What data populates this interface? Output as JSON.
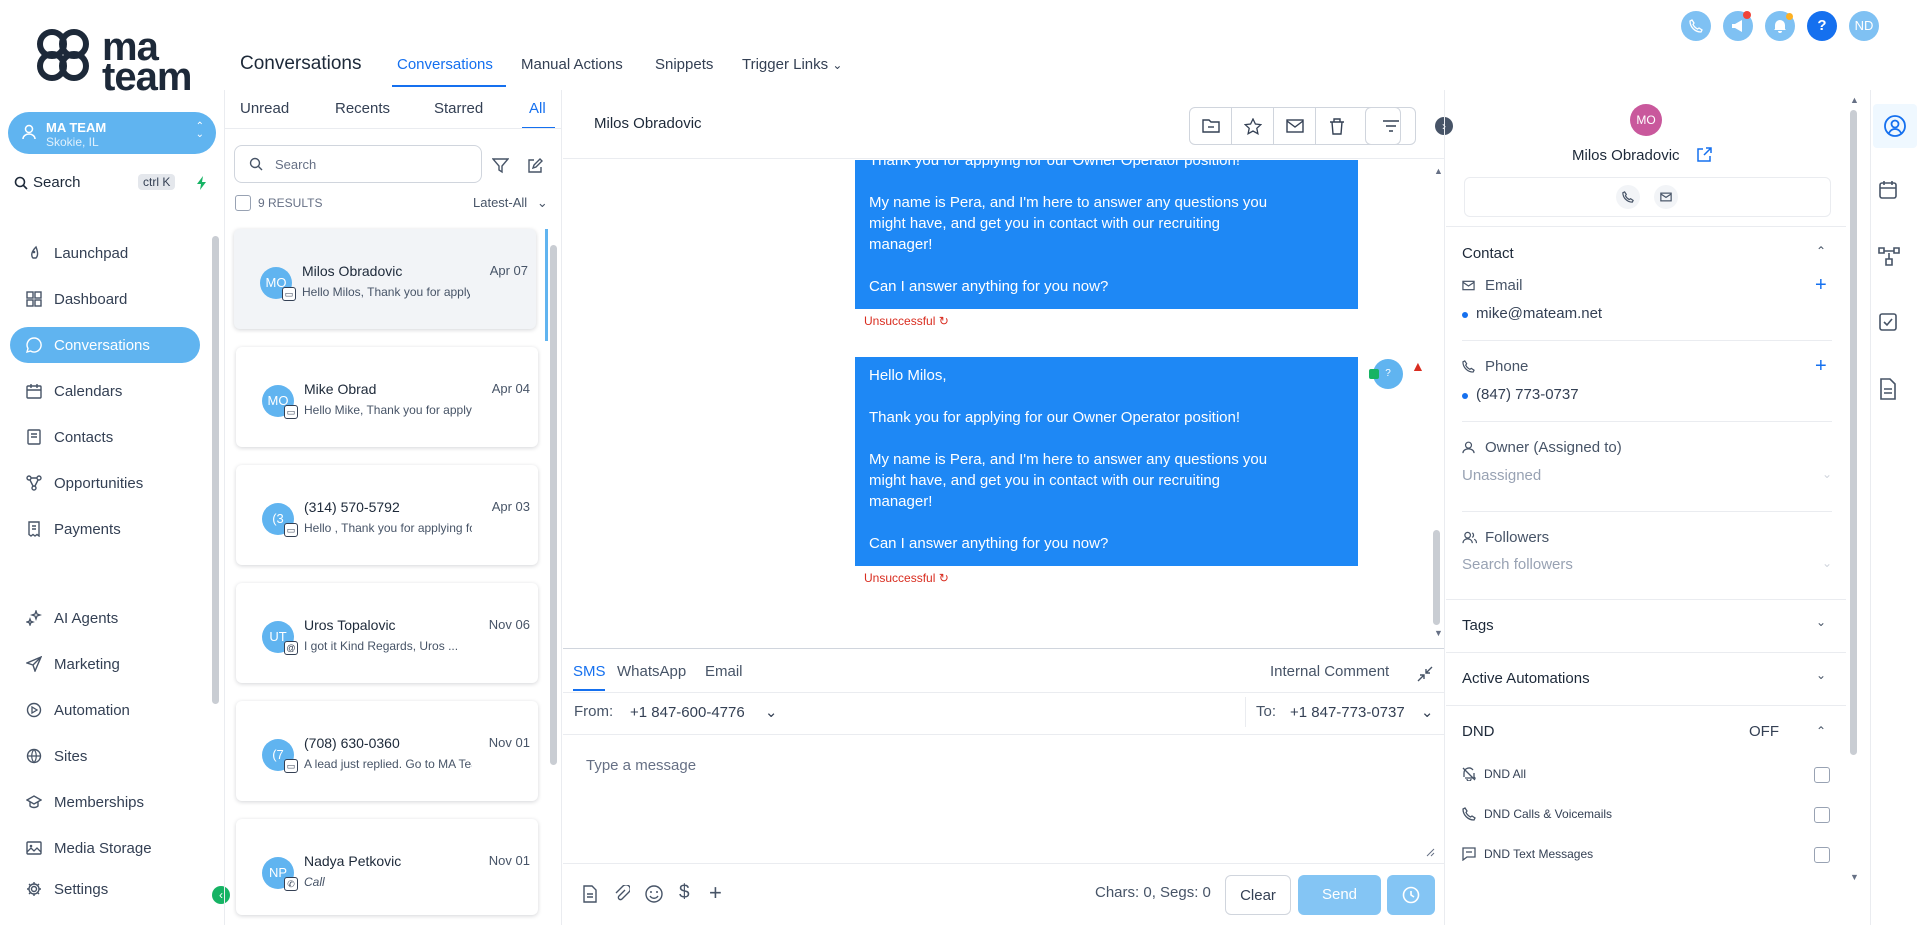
{
  "brand": {
    "logo_text": "ma team"
  },
  "account": {
    "name": "MA TEAM",
    "location": "Skokie, IL"
  },
  "sidebar": {
    "search_label": "Search",
    "search_shortcut": "ctrl K",
    "items": [
      {
        "label": "Launchpad",
        "icon": "rocket-icon"
      },
      {
        "label": "Dashboard",
        "icon": "grid-icon"
      },
      {
        "label": "Conversations",
        "icon": "chat-bubble-icon"
      },
      {
        "label": "Calendars",
        "icon": "calendar-icon"
      },
      {
        "label": "Contacts",
        "icon": "address-book-icon"
      },
      {
        "label": "Opportunities",
        "icon": "network-icon"
      },
      {
        "label": "Payments",
        "icon": "receipt-icon"
      },
      {
        "label": "AI Agents",
        "icon": "sparkle-icon"
      },
      {
        "label": "Marketing",
        "icon": "send-icon"
      },
      {
        "label": "Automation",
        "icon": "automation-icon"
      },
      {
        "label": "Sites",
        "icon": "globe-icon"
      },
      {
        "label": "Memberships",
        "icon": "graduation-cap-icon"
      },
      {
        "label": "Media Storage",
        "icon": "image-icon"
      },
      {
        "label": "Settings",
        "icon": "gear-icon"
      }
    ]
  },
  "header": {
    "title": "Conversations",
    "tabs": [
      "Conversations",
      "Manual Actions",
      "Snippets",
      "Trigger Links"
    ],
    "user_initials": "ND",
    "help": "?"
  },
  "list": {
    "filters": [
      "Unread",
      "Recents",
      "Starred",
      "All"
    ],
    "search_placeholder": "Search",
    "results": "9 RESULTS",
    "sort": "Latest-All",
    "conversations": [
      {
        "initials": "MO",
        "name": "Milos Obradovic",
        "date": "Apr 07",
        "preview": "Hello Milos, Thank you for applying",
        "channel": "sms"
      },
      {
        "initials": "MO",
        "name": "Mike Obrad",
        "date": "Apr 04",
        "preview": "Hello Mike, Thank you for applying",
        "channel": "sms"
      },
      {
        "initials": "(3",
        "name": "(314) 570-5792",
        "date": "Apr 03",
        "preview": "Hello , Thank you for applying for",
        "channel": "sms"
      },
      {
        "initials": "UT",
        "name": "Uros Topalovic",
        "date": "Nov 06",
        "preview": "I got it Kind Regards, Uros ...",
        "channel": "email"
      },
      {
        "initials": "(7",
        "name": "(708) 630-0360",
        "date": "Nov 01",
        "preview": "A lead just replied. Go to MA Team",
        "channel": "sms"
      },
      {
        "initials": "NP",
        "name": "Nadya Petkovic",
        "date": "Nov 01",
        "preview": "Call",
        "channel": "call"
      }
    ]
  },
  "chat": {
    "contact_name": "Milos Obradovic",
    "messages": [
      {
        "lines": [
          "Thank you for applying for our Owner Operator position!",
          "",
          "My name is Pera, and I'm here to answer any questions you",
          "might have, and get you in contact with our recruiting",
          "manager!",
          "",
          "Can I answer anything for you now?"
        ],
        "status": "Unsuccessful"
      },
      {
        "lines": [
          "Hello Milos,",
          "",
          "Thank you for applying for our Owner Operator position!",
          "",
          "My name is Pera, and I'm here to answer any questions you",
          "might have, and get you in contact with our recruiting",
          "manager!",
          "",
          "Can I answer anything for you now?"
        ],
        "status": "Unsuccessful",
        "avatar": "?"
      }
    ]
  },
  "composer": {
    "tabs": [
      "SMS",
      "WhatsApp",
      "Email"
    ],
    "internal_comment": "Internal Comment",
    "from_label": "From:",
    "from_number": "+1 847-600-4776",
    "to_label": "To:",
    "to_number": "+1 847-773-0737",
    "placeholder": "Type a message",
    "counter": "Chars: 0, Segs: 0",
    "clear": "Clear",
    "send": "Send"
  },
  "contact": {
    "initials": "MO",
    "name": "Milos Obradovic",
    "contact_section": "Contact",
    "email_label": "Email",
    "email": "mike@mateam.net",
    "phone_label": "Phone",
    "phone": "(847) 773-0737",
    "owner_label": "Owner (Assigned to)",
    "owner_value": "Unassigned",
    "followers_label": "Followers",
    "followers_placeholder": "Search followers",
    "tags": "Tags",
    "automations": "Active Automations",
    "dnd": "DND",
    "dnd_state": "OFF",
    "dnd_options": [
      "DND All",
      "DND Calls & Voicemails",
      "DND Text Messages"
    ]
  },
  "colors": {
    "accent": "#1570ef",
    "active_nav": "#60b4f0",
    "bubble": "#1e88f5",
    "error": "#d92d20"
  }
}
